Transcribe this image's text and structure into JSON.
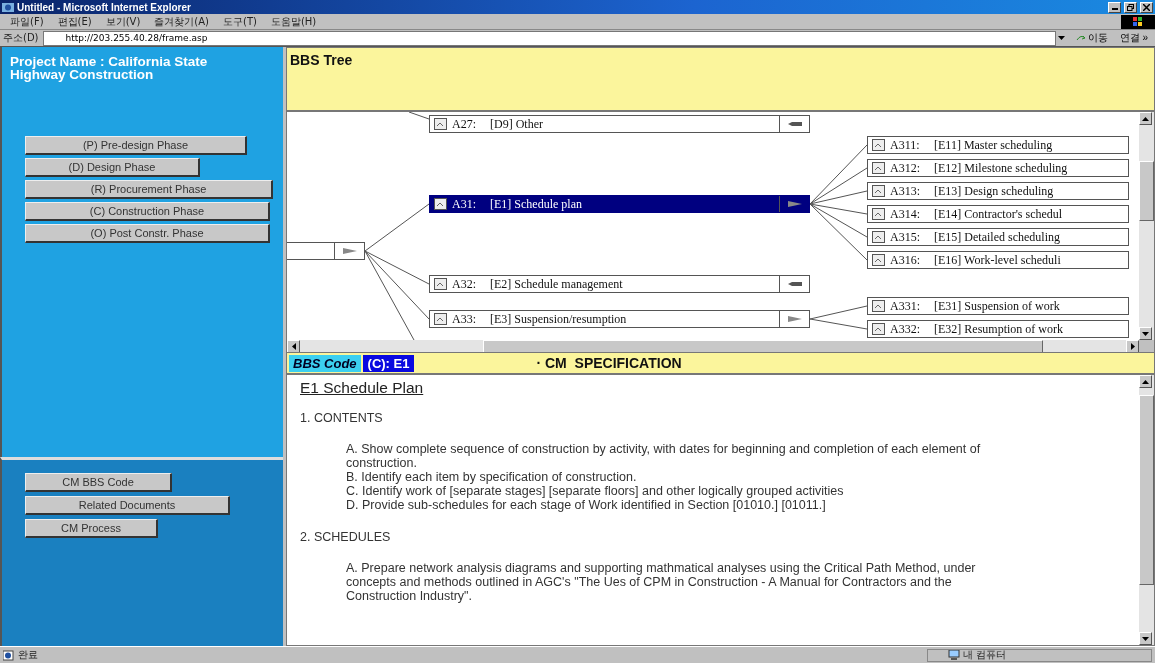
{
  "window": {
    "title": "Untitled - Microsoft Internet Explorer"
  },
  "menu": [
    "파일(F)",
    "편집(E)",
    "보기(V)",
    "즐겨찾기(A)",
    "도구(T)",
    "도움말(H)"
  ],
  "address_bar": {
    "label": "주소(D)",
    "value": "http://203.255.40.28/frame.asp",
    "go_button": "이동",
    "links": "연결 »"
  },
  "sidebar": {
    "project_name": "Project Name : California State Highway Construction",
    "phases": [
      "(P) Pre-design Phase",
      "(D) Design Phase",
      "(R) Procurement Phase",
      "(C) Construction Phase",
      "(O) Post Constr. Phase"
    ],
    "tools": [
      "CM BBS Code",
      "Related Documents",
      "CM Process"
    ]
  },
  "tree": {
    "title": "BBS Tree",
    "nodes": [
      {
        "code": "A27:",
        "label": "[D9] Other",
        "selected": false,
        "expanded": false
      },
      {
        "code": "A31:",
        "label": "[E1] Schedule plan",
        "selected": true,
        "expanded": true,
        "children": [
          {
            "code": "A311:",
            "label": "[E11] Master scheduling"
          },
          {
            "code": "A312:",
            "label": "[E12] Milestone scheduling"
          },
          {
            "code": "A313:",
            "label": "[E13] Design scheduling"
          },
          {
            "code": "A314:",
            "label": "[E14] Contractor's schedul"
          },
          {
            "code": "A315:",
            "label": "[E15] Detailed scheduling"
          },
          {
            "code": "A316:",
            "label": "[E16] Work-level scheduli"
          }
        ]
      },
      {
        "code": "A32:",
        "label": "[E2] Schedule management",
        "selected": false,
        "expanded": false
      },
      {
        "code": "A33:",
        "label": "[E3] Suspension/resumption",
        "selected": false,
        "expanded": true,
        "children": [
          {
            "code": "A331:",
            "label": "[E31] Suspension of work"
          },
          {
            "code": "A332:",
            "label": "[E32] Resumption of work"
          }
        ]
      }
    ]
  },
  "code_bar": {
    "label": "BBS Code",
    "code": "(C): E1",
    "heading": "· CM  SPECIFICATION"
  },
  "document": {
    "title": "E1 Schedule Plan",
    "sections": [
      {
        "heading": "1. CONTENTS",
        "items": [
          "A. Show complete sequence of construction by activity, with dates for beginning and completion of each element of construction.",
          "B. Identify each item by specification of construction.",
          "C. Identify work of [separate stages] [separate floors] and other logically grouped activities",
          "D. Provide sub-schedules for each stage of Work identified in Section [01010.] [01011.]"
        ]
      },
      {
        "heading": "2. SCHEDULES",
        "items": [
          "A. Prepare network analysis diagrams and supporting mathmatical analyses using the Critical Path Method, under concepts and methods outlined in AGC's \"The Ues of CPM in Construction - A Manual for Contractors and the Construction Industry\"."
        ]
      }
    ]
  },
  "status_bar": {
    "status": "완료",
    "zone": "내 컴퓨터"
  }
}
